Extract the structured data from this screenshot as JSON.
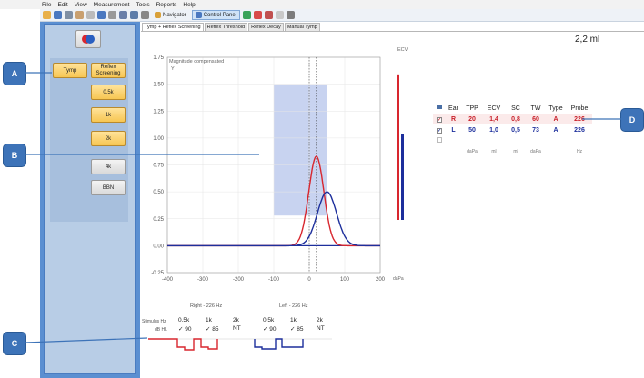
{
  "menu": [
    "File",
    "Edit",
    "View",
    "Measurement",
    "Tools",
    "Reports",
    "Help"
  ],
  "toolbar": {
    "navigator_label": "Navigator",
    "control_panel_label": "Control Panel"
  },
  "left": {
    "tymp": "Tymp",
    "reflex": "Reflex Screening",
    "freqs": [
      "0.5k",
      "1k",
      "2k",
      "4k",
      "BBN"
    ]
  },
  "tabs": [
    "Tymp + Reflex Screening",
    "Reflex Threshold",
    "Reflex Decay",
    "Manual Tymp"
  ],
  "ecv_value": "2,2 ml",
  "ecv_label": "ECV",
  "graph": {
    "annotation": "Magnitude compensated",
    "annotation2": "Y",
    "xunit": "daPa"
  },
  "callouts": [
    "A",
    "B",
    "C",
    "D"
  ],
  "results": {
    "headers": [
      "Ear",
      "TPP",
      "ECV",
      "SC",
      "TW",
      "Type",
      "Probe"
    ],
    "units": [
      "daPa",
      "ml",
      "ml",
      "daPa",
      "",
      "Hz"
    ],
    "rows": [
      {
        "ear": "R",
        "tpp": "20",
        "ecv": "1,4",
        "sc": "0,8",
        "tw": "60",
        "type": "A",
        "probe": "226",
        "color": "#c8202a"
      },
      {
        "ear": "L",
        "tpp": "50",
        "ecv": "1,0",
        "sc": "0,5",
        "tw": "73",
        "type": "A",
        "probe": "226",
        "color": "#1d2f9c"
      }
    ]
  },
  "reflex": {
    "right_title": "Right - 226 Hz",
    "left_title": "Left - 226 Hz",
    "stim_label": "Stimulus Hz",
    "db_label": "dB HL",
    "right": [
      {
        "f": "0.5k",
        "v": "✓ 90"
      },
      {
        "f": "1k",
        "v": "✓ 85"
      },
      {
        "f": "2k",
        "v": "NT"
      }
    ],
    "left": [
      {
        "f": "0.5k",
        "v": "✓ 90"
      },
      {
        "f": "1k",
        "v": "✓ 85"
      },
      {
        "f": "2k",
        "v": "NT"
      }
    ]
  },
  "chart_data": {
    "type": "line",
    "xlim": [
      -400,
      200
    ],
    "ylim": [
      -0.25,
      1.75
    ],
    "xticks": [
      "-400",
      "-300",
      "-200",
      "-100",
      "0",
      "100",
      "200"
    ],
    "yticks": [
      "1.75",
      "1.50",
      "1.25",
      "1.00",
      "0.75",
      "0.50",
      "0.25",
      "0.00",
      "-0.25"
    ],
    "series": [
      {
        "ear": "right",
        "color": "#d8262e",
        "peak_x": 20,
        "peak_y": 0.83,
        "width": 30
      },
      {
        "ear": "left",
        "color": "#1d2f9c",
        "peak_x": 50,
        "peak_y": 0.5,
        "width": 38
      }
    ],
    "shaded_x": [
      -100,
      50
    ],
    "shaded_y": [
      0.28,
      1.5
    ],
    "ecv_bars": {
      "right": 2.2,
      "left": 1.3,
      "max": 2.5
    }
  }
}
